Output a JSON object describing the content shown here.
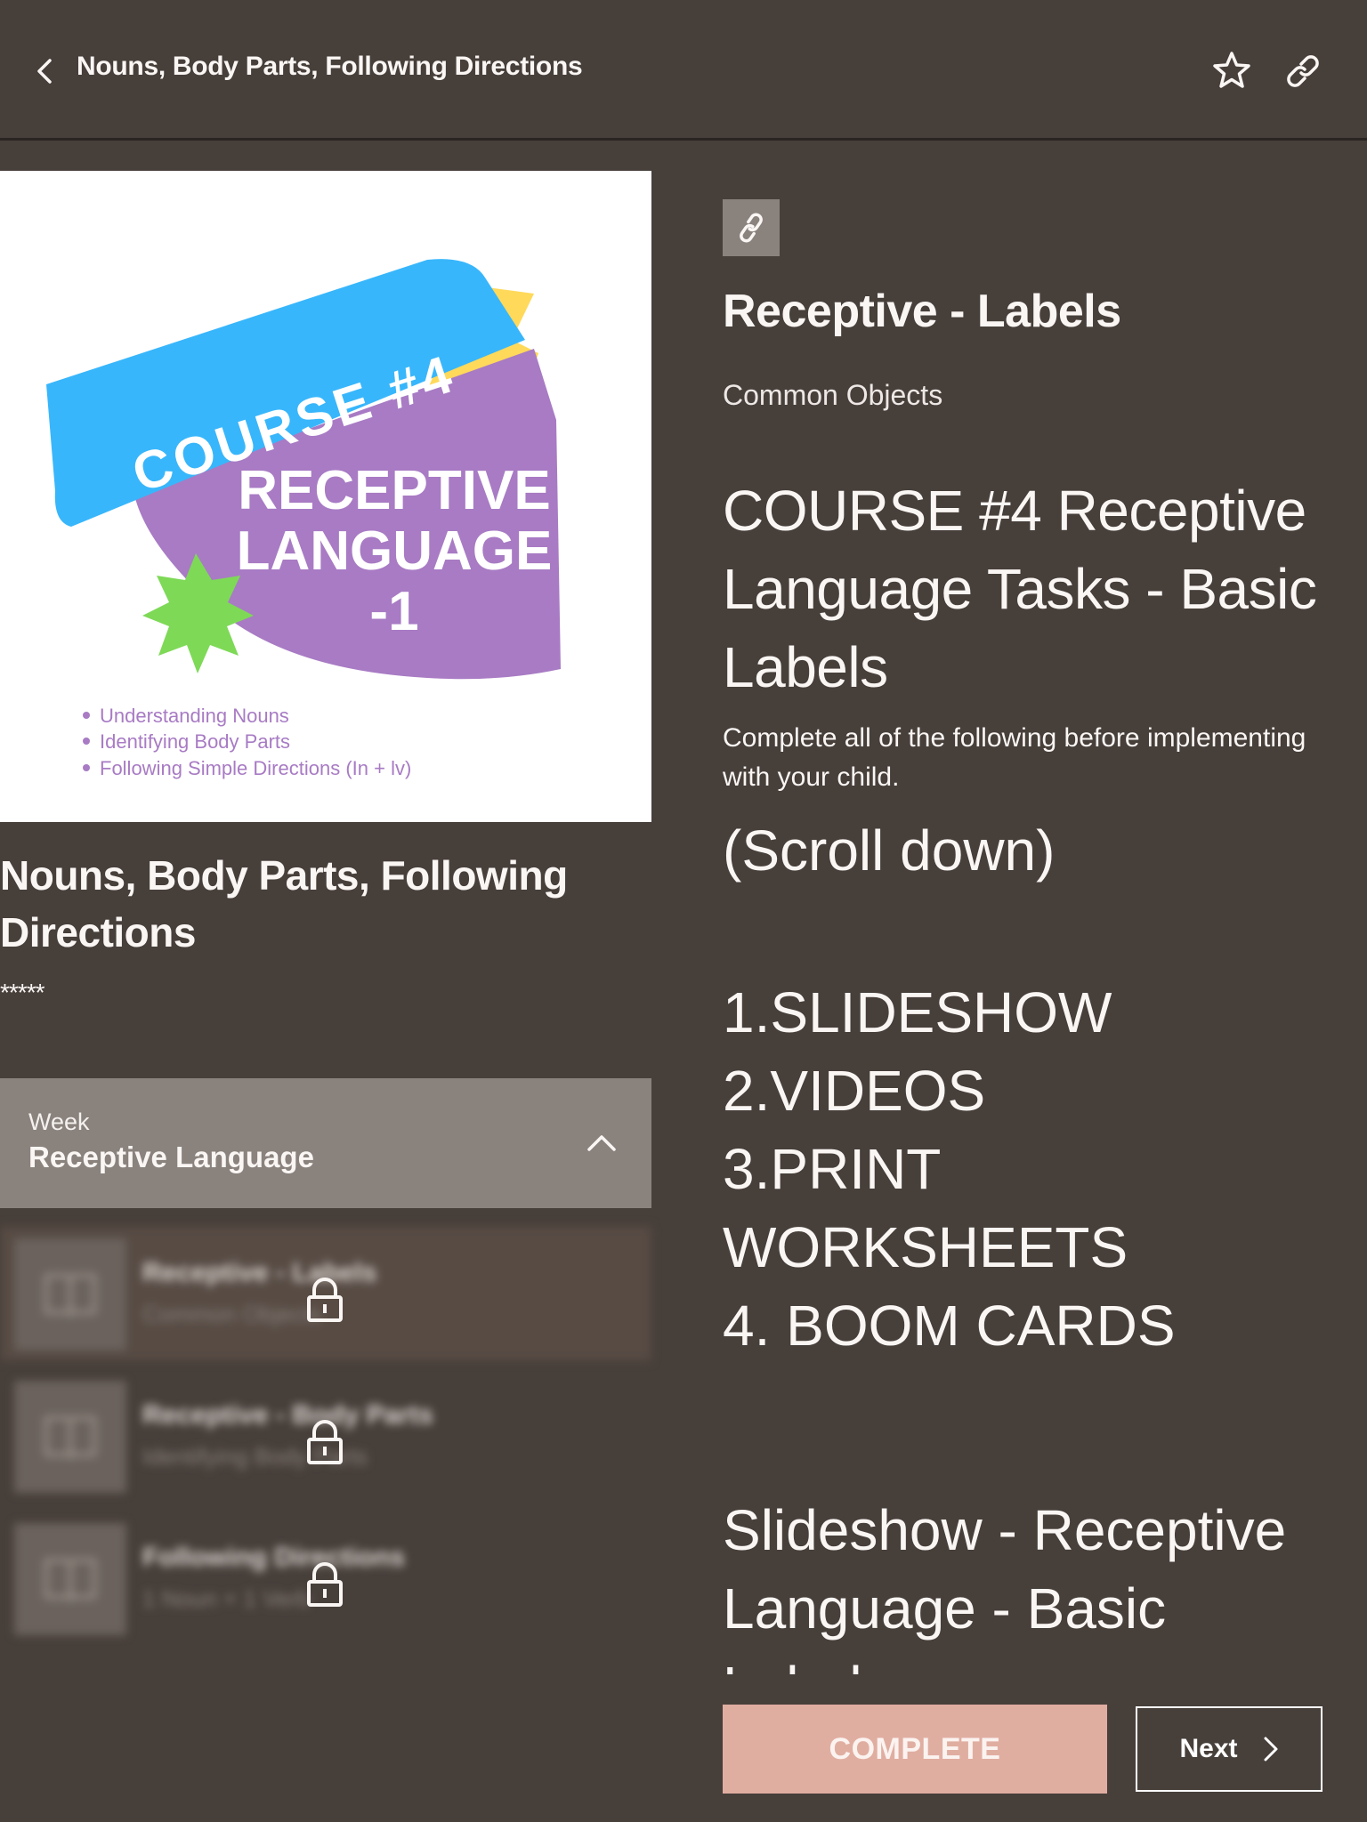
{
  "header": {
    "title": "Nouns, Body Parts, Following Directions",
    "icons": {
      "back": "chevron-left-icon",
      "favorite": "star-icon",
      "share": "link-icon"
    }
  },
  "cover": {
    "banner_text": "COURSE #4",
    "main_text_line1": "RECEPTIVE",
    "main_text_line2": "LANGUAGE",
    "main_text_line3": "-1",
    "bullets": [
      "Understanding Nouns",
      "Identifying Body Parts",
      "Following Simple Directions (In + lv)"
    ],
    "colors": {
      "banner": "#38b6fb",
      "shape": "#a87bc4",
      "star": "#7ed957",
      "ribbon": "#ffd95a",
      "bullet_text": "#a87bc4"
    }
  },
  "course": {
    "title": "Nouns, Body Parts, Following Directions",
    "rating": "*****"
  },
  "week": {
    "label": "Week",
    "name": "Receptive Language",
    "expanded": true
  },
  "lessons": [
    {
      "title": "Receptive - Labels",
      "subtitle": "Common Objects",
      "locked": true,
      "active": true
    },
    {
      "title": "Receptive - Body Parts",
      "subtitle": "Identifying Body Parts",
      "locked": true,
      "active": false
    },
    {
      "title": "Following Directions",
      "subtitle": "1 Noun + 1 Verb",
      "locked": true,
      "active": false
    }
  ],
  "lesson_detail": {
    "title": "Receptive - Labels",
    "subtitle": "Common Objects",
    "content": {
      "heading": "COURSE #4 Receptive Language Tasks - Basic Labels",
      "intro": "Complete all of the following before implementing with your child.",
      "scroll_hint": "(Scroll down)",
      "steps": [
        "1.SLIDESHOW",
        "2.VIDEOS",
        "3.PRINT WORKSHEETS",
        "4. BOOM CARDS"
      ],
      "section_heading": "Slideshow - Receptive Language - Basic Labels"
    }
  },
  "actions": {
    "complete_label": "COMPLETE",
    "next_label": "Next"
  },
  "colors": {
    "background": "#473f3a",
    "panel": "#8a827d",
    "complete_button": "#e0aea1",
    "text": "#faf6f4"
  }
}
